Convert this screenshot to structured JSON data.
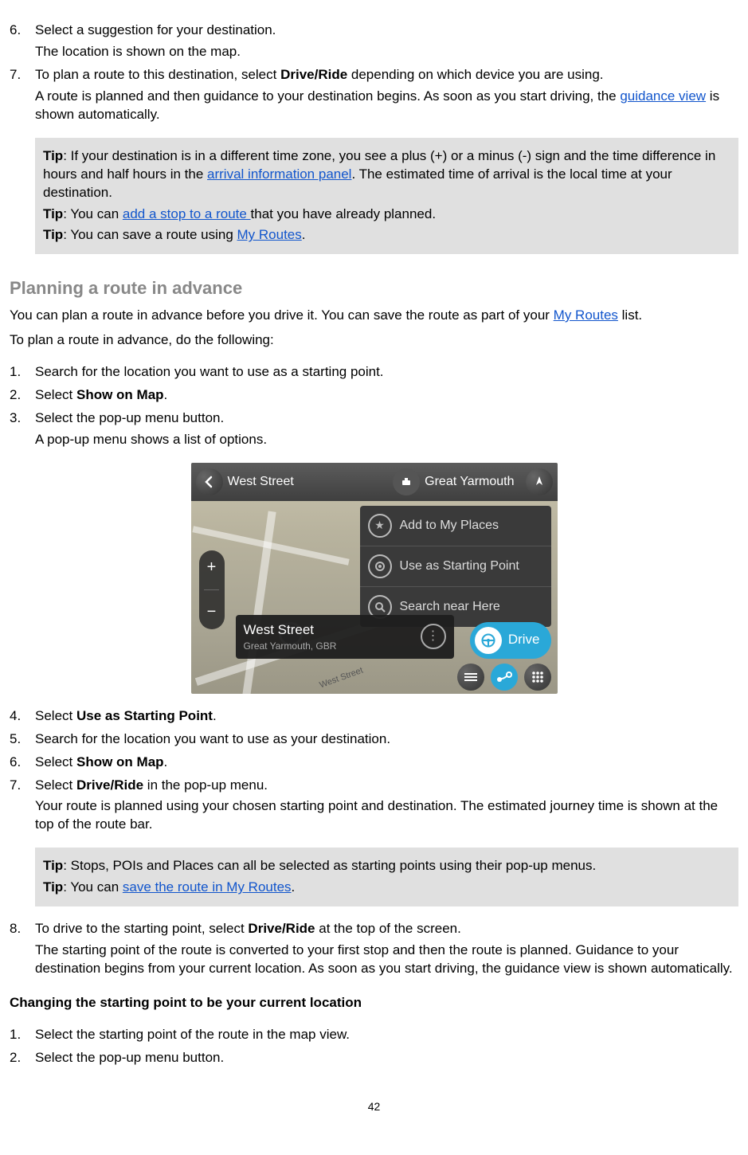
{
  "list_a": {
    "item6": {
      "marker": "6.",
      "text": "Select a suggestion for your destination.",
      "p2": "The location is shown on the map."
    },
    "item7": {
      "marker": "7.",
      "text_a": "To plan a route to this destination, select ",
      "bold": "Drive/Ride",
      "text_b": " depending on which device you are using.",
      "p2a": "A route is planned and then guidance to your destination begins. As soon as you start driving, the ",
      "link": "guidance view",
      "p2b": " is shown automatically."
    }
  },
  "tipbox1": {
    "t1a": "Tip",
    "t1b": ": If your destination is in a different time zone, you see a plus (+) or a minus (-) sign and the time difference in hours and half hours in the ",
    "t1link": "arrival information panel",
    "t1c": ". The estimated time of arrival is the local time at your destination.",
    "t2a": "Tip",
    "t2b": ": You can ",
    "t2link": "add a stop to a route  ",
    "t2c": " that you have already planned.",
    "t3a": "Tip",
    "t3b": ": You can save a route using ",
    "t3link": "My Routes",
    "t3c": "."
  },
  "section": {
    "title": "Planning a route in advance",
    "p1a": "You can plan a route in advance before you drive it. You can save the route as part of your ",
    "p1link": "My Routes",
    "p1b": " list.",
    "p2": "To plan a route in advance, do the following:"
  },
  "list_b": {
    "item1": {
      "marker": "1.",
      "text": "Search for the location you want to use as a starting point."
    },
    "item2": {
      "marker": "2.",
      "text_a": "Select ",
      "bold": "Show on Map",
      "text_b": "."
    },
    "item3": {
      "marker": "3.",
      "text": "Select the pop-up menu button.",
      "p2": "A pop-up menu shows a list of options."
    },
    "item4": {
      "marker": "4.",
      "text_a": "Select ",
      "bold": "Use as Starting Point",
      "text_b": "."
    },
    "item5": {
      "marker": "5.",
      "text": "Search for the location you want to use as your destination."
    },
    "item6": {
      "marker": "6.",
      "text_a": "Select ",
      "bold": "Show on Map",
      "text_b": "."
    },
    "item7": {
      "marker": "7.",
      "text_a": "Select ",
      "bold": "Drive/Ride",
      "text_b": " in the pop-up menu.",
      "p2": "Your route is planned using your chosen starting point and destination. The estimated journey time is shown at the top of the route bar."
    },
    "item8": {
      "marker": "8.",
      "text_a": "To drive to the starting point, select ",
      "bold": "Drive/Ride",
      "text_b": " at the top of the screen.",
      "p2": "The starting point of the route is converted to your first stop and then the route is planned. Guidance to your destination begins from your current location. As soon as you start driving, the guidance view is shown automatically."
    }
  },
  "tipbox2": {
    "t1a": "Tip",
    "t1b": ": Stops, POIs and Places can all be selected as starting points using their pop-up menus.",
    "t2a": "Tip",
    "t2b": ": You can ",
    "t2link": "save the route in My Routes",
    "t2c": "."
  },
  "sub1": {
    "title": "Changing the starting point to be your current location"
  },
  "list_c": {
    "item1": {
      "marker": "1.",
      "text": "Select the starting point of the route in the map view."
    },
    "item2": {
      "marker": "2.",
      "text": "Select the pop-up menu button."
    }
  },
  "page_number": "42",
  "device": {
    "title_left": "West Street",
    "title_right": "Great Yarmouth",
    "menu": {
      "add": "Add to My Places",
      "use": "Use as Starting Point",
      "search": "Search near Here"
    },
    "card": {
      "title": "West Street",
      "sub": "Great Yarmouth, GBR"
    },
    "drive": "Drive",
    "street_label": "West Street"
  }
}
